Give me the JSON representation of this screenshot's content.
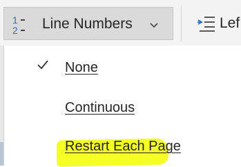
{
  "ribbon": {
    "line_numbers_button": {
      "label": "Line Numbers",
      "icon": "line-numbers-icon"
    },
    "indent_button": {
      "label": "Lef",
      "icon": "indent-left-icon"
    }
  },
  "menu": {
    "items": [
      {
        "label": "None",
        "checked": true,
        "highlighted": false
      },
      {
        "label": "Continuous",
        "checked": false,
        "highlighted": true
      },
      {
        "label": "Restart Each Page",
        "checked": false,
        "highlighted": false
      }
    ]
  },
  "colors": {
    "ribbon_bg": "#f3f3f3",
    "button_active_bg": "#dadada",
    "highlight": "#f4ff24",
    "icon_blue": "#2b6cc4",
    "text": "#262626"
  }
}
